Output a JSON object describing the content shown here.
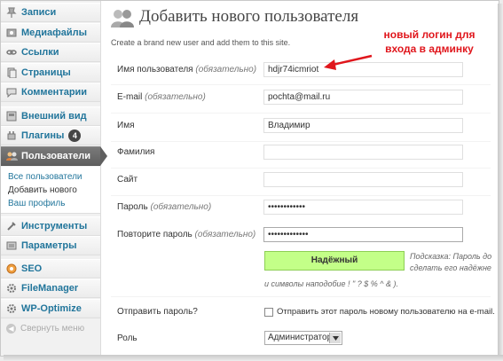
{
  "sidebar": {
    "items": [
      {
        "label": "Записи",
        "icon": "pin-icon"
      },
      {
        "label": "Медиафайлы",
        "icon": "media-icon"
      },
      {
        "label": "Ссылки",
        "icon": "link-icon"
      },
      {
        "label": "Страницы",
        "icon": "pages-icon"
      },
      {
        "label": "Комментарии",
        "icon": "comment-icon"
      },
      {
        "label": "Внешний вид",
        "icon": "appearance-icon"
      },
      {
        "label": "Плагины",
        "icon": "plugin-icon",
        "badge": "4"
      },
      {
        "label": "Пользователи",
        "icon": "users-icon",
        "active": true
      },
      {
        "label": "Инструменты",
        "icon": "tools-icon"
      },
      {
        "label": "Параметры",
        "icon": "settings-icon"
      },
      {
        "label": "SEO",
        "icon": "seo-icon"
      },
      {
        "label": "FileManager",
        "icon": "gear-icon"
      },
      {
        "label": "WP-Optimize",
        "icon": "gear-icon"
      }
    ],
    "submenu": [
      "Все пользователи",
      "Добавить нового",
      "Ваш профиль"
    ],
    "collapse_label": "Свернуть меню"
  },
  "page": {
    "title": "Добавить нового пользователя",
    "intro": "Create a brand new user and add them to this site."
  },
  "form": {
    "username_label": "Имя пользователя",
    "required": "(обязательно)",
    "username_value": "hdjr74icmriot",
    "email_label": "E-mail",
    "email_value": "pochta@mail.ru",
    "firstname_label": "Имя",
    "firstname_value": "Владимир",
    "lastname_label": "Фамилия",
    "lastname_value": "",
    "site_label": "Сайт",
    "site_value": "",
    "password_label": "Пароль",
    "password_value": "••••••••••••",
    "password2_label": "Повторите пароль",
    "password2_value": "•••••••••••••",
    "strength": "Надёжный",
    "hint_line1": "Подсказка: Пароль до",
    "hint_line2": "сделать его надёжне",
    "hint_line3": "и символы наподобие ! \" ? $ % ^ & ).",
    "send_password_label": "Отправить пароль?",
    "send_password_checkbox": "Отправить этот пароль новому пользователю на e-mail.",
    "role_label": "Роль",
    "role_value": "Администратор"
  },
  "annotation": {
    "line1": "новый логин для",
    "line2": "входа в админку",
    "color": "#e0161c"
  },
  "colors": {
    "link": "#21759b",
    "active_menu": "#6d6d6d",
    "strength_bg": "#c3ff88"
  }
}
